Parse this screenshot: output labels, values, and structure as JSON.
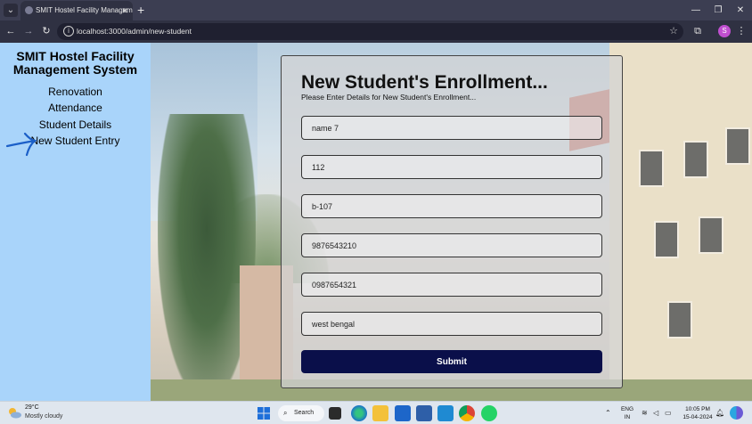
{
  "browser": {
    "tab_title": "SMIT Hostel Facility Manageme",
    "tab_close": "✕",
    "new_tab": "+",
    "url": "localhost:3000/admin/new-student",
    "profile_initial": "S"
  },
  "sidebar": {
    "title": "SMIT Hostel Facility Management System",
    "items": [
      {
        "label": "Renovation"
      },
      {
        "label": "Attendance"
      },
      {
        "label": "Student Details"
      },
      {
        "label": "New Student Entry"
      }
    ]
  },
  "form": {
    "title": "New Student's Enrollment...",
    "subtitle": "Please Enter Details for New Student's Enrollment...",
    "fields": [
      {
        "value": "name 7"
      },
      {
        "value": "112"
      },
      {
        "value": "b-107"
      },
      {
        "value": "9876543210"
      },
      {
        "value": "0987654321"
      },
      {
        "value": "west bengal"
      }
    ],
    "submit_label": "Submit"
  },
  "taskbar": {
    "temperature": "29°C",
    "weather": "Mostly cloudy",
    "search_label": "Search",
    "language": "ENG",
    "region": "IN",
    "time": "10:05 PM",
    "date": "15-04-2024"
  },
  "colors": {
    "sidebar_bg": "#a9d4fa",
    "submit_bg": "#0a0f4a",
    "tabbar_bg": "#3c3e52"
  }
}
